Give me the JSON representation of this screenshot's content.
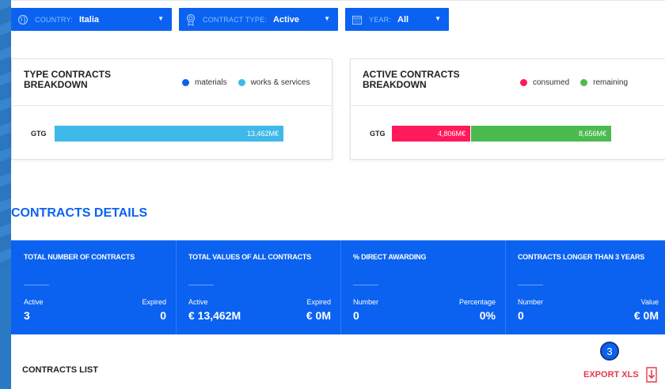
{
  "filters": {
    "country": {
      "label": "COUNTRY:",
      "value": "Italia",
      "icon": "globe-icon"
    },
    "contract_type": {
      "label": "CONTRACT TYPE:",
      "value": "Active",
      "icon": "award-icon"
    },
    "year": {
      "label": "YEAR:",
      "value": "All",
      "icon": "calendar-icon"
    }
  },
  "type_breakdown": {
    "title": "TYPE CONTRACTS BREAKDOWN",
    "legend": [
      {
        "label": "materials",
        "color": "#0b62f0"
      },
      {
        "label": "works & services",
        "color": "#3fb8ea"
      }
    ],
    "row_label": "GTG",
    "bar_value": "13,462M€",
    "bar_color": "#3fb8ea"
  },
  "active_breakdown": {
    "title": "ACTIVE CONTRACTS BREAKDOWN",
    "legend": [
      {
        "label": "consumed",
        "color": "#ff1a5b"
      },
      {
        "label": "remaining",
        "color": "#4cbb4f"
      }
    ],
    "row_label": "GTG",
    "consumed_value": "4,806M€",
    "remaining_value": "8,656M€",
    "consumed_color": "#ff1a5b",
    "remaining_color": "#4cbb4f"
  },
  "details": {
    "title": "CONTRACTS DETAILS",
    "columns": [
      {
        "header": "TOTAL NUMBER OF CONTRACTS",
        "left_label": "Active",
        "left_value": "3",
        "right_label": "Expired",
        "right_value": "0"
      },
      {
        "header": "TOTAL VALUES OF ALL CONTRACTS",
        "left_label": "Active",
        "left_value": "€ 13,462M",
        "right_label": "Expired",
        "right_value": "€ 0M"
      },
      {
        "header": "% DIRECT AWARDING",
        "left_label": "Number",
        "left_value": "0",
        "right_label": "Percentage",
        "right_value": "0%"
      },
      {
        "header": "CONTRACTS LONGER THAN 3 YEARS",
        "left_label": "Number",
        "left_value": "0",
        "right_label": "Value",
        "right_value": "€ 0M"
      }
    ]
  },
  "contracts_list": {
    "title": "CONTRACTS LIST"
  },
  "badge": {
    "count": "3"
  },
  "export": {
    "label": "EXPORT XLS",
    "icon": "download-icon"
  }
}
